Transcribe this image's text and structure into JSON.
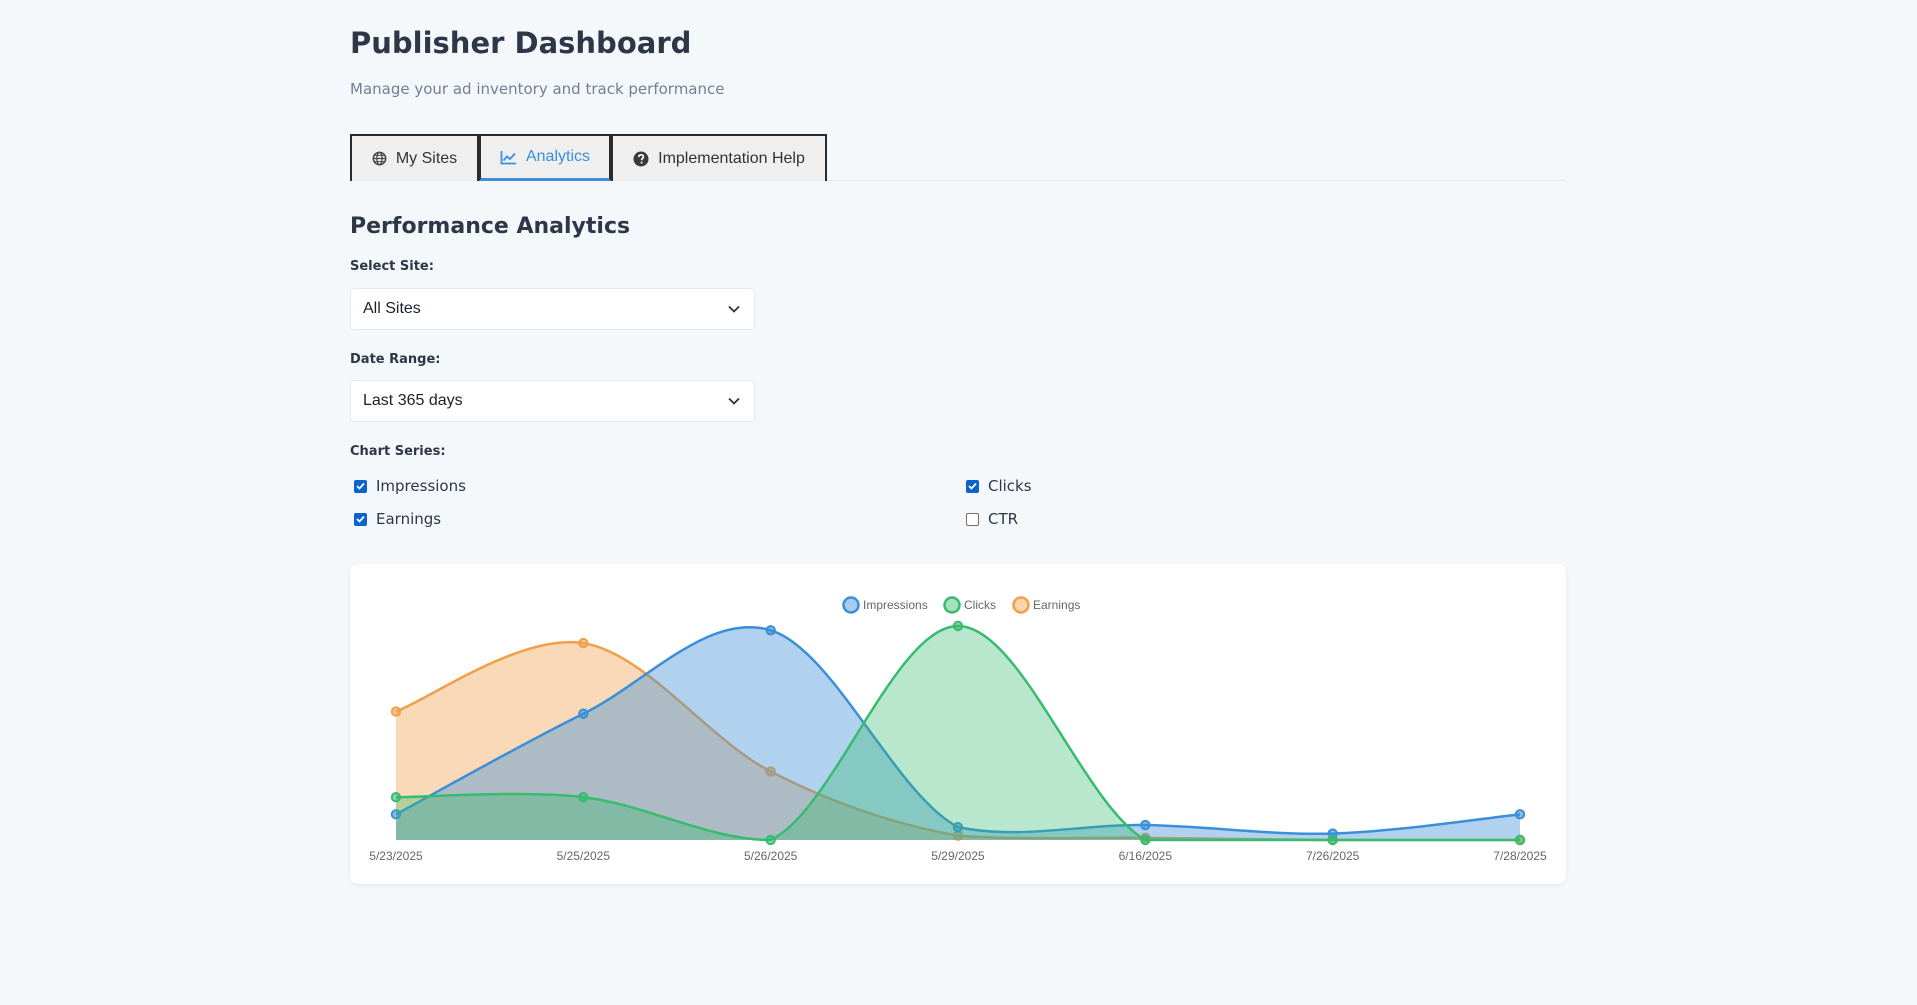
{
  "header": {
    "title": "Publisher Dashboard",
    "subtitle": "Manage your ad inventory and track performance"
  },
  "tabs": [
    {
      "label": "My Sites",
      "icon": "globe-icon",
      "active": false
    },
    {
      "label": "Analytics",
      "icon": "chart-line-icon",
      "active": true
    },
    {
      "label": "Implementation Help",
      "icon": "question-circle-icon",
      "active": false
    }
  ],
  "analytics": {
    "title": "Performance Analytics",
    "site_label": "Select Site:",
    "site_value": "All Sites",
    "range_label": "Date Range:",
    "range_value": "Last 365 days",
    "series_label": "Chart Series:",
    "series_options": [
      {
        "label": "Impressions",
        "checked": true
      },
      {
        "label": "Clicks",
        "checked": true
      },
      {
        "label": "Earnings",
        "checked": true
      },
      {
        "label": "CTR",
        "checked": false
      }
    ]
  },
  "colors": {
    "impressions": "#3b8fd8",
    "clicks": "#36bb6f",
    "earnings": "#f1a04a",
    "accent": "#3b8fd8"
  },
  "chart_data": {
    "type": "area",
    "categories": [
      "5/23/2025",
      "5/25/2025",
      "5/26/2025",
      "5/29/2025",
      "6/16/2025",
      "7/26/2025",
      "7/28/2025"
    ],
    "legend_position": "top-center",
    "grid": false,
    "series": [
      {
        "name": "Impressions",
        "values": [
          0.12,
          0.59,
          0.98,
          0.06,
          0.07,
          0.03,
          0.12
        ]
      },
      {
        "name": "Clicks",
        "values": [
          0.2,
          0.2,
          0.0,
          1.0,
          0.0,
          0.0,
          0.0
        ]
      },
      {
        "name": "Earnings",
        "values": [
          0.6,
          0.92,
          0.32,
          0.02,
          0.01,
          0.0,
          0.0
        ]
      }
    ],
    "ylim": [
      0,
      1
    ]
  }
}
